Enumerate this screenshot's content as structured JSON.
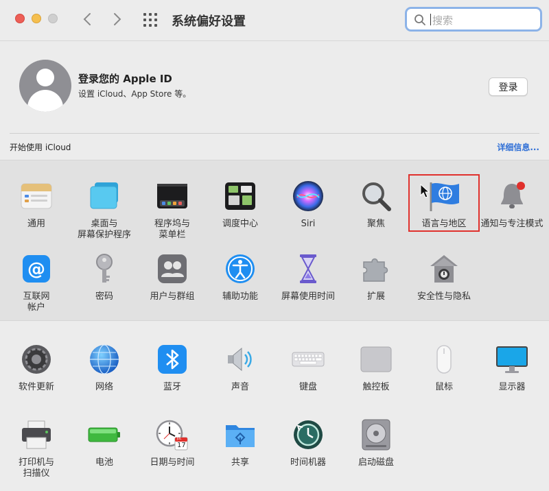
{
  "window": {
    "title": "系统偏好设置"
  },
  "search": {
    "placeholder": "搜索"
  },
  "account": {
    "title": "登录您的 Apple ID",
    "subtitle": "设置 iCloud、App Store 等。",
    "login_label": "登录",
    "icloud_label": "开始使用 iCloud",
    "details_label": "详细信息..."
  },
  "section1": [
    {
      "label": "通用",
      "icon": "general-icon"
    },
    {
      "label": "桌面与\n屏幕保护程序",
      "icon": "desktop-screensaver-icon"
    },
    {
      "label": "程序坞与\n菜单栏",
      "icon": "dock-menubar-icon"
    },
    {
      "label": "调度中心",
      "icon": "mission-control-icon"
    },
    {
      "label": "Siri",
      "icon": "siri-icon"
    },
    {
      "label": "聚焦",
      "icon": "spotlight-icon"
    },
    {
      "label": "语言与地区",
      "icon": "language-region-icon"
    },
    {
      "label": "通知与专注模式",
      "icon": "notifications-icon"
    },
    {
      "label": "互联网\n帐户",
      "icon": "internet-accounts-icon"
    },
    {
      "label": "密码",
      "icon": "passwords-icon"
    },
    {
      "label": "用户与群组",
      "icon": "users-groups-icon"
    },
    {
      "label": "辅助功能",
      "icon": "accessibility-icon"
    },
    {
      "label": "屏幕使用时间",
      "icon": "screen-time-icon"
    },
    {
      "label": "扩展",
      "icon": "extensions-icon"
    },
    {
      "label": "安全性与隐私",
      "icon": "security-privacy-icon"
    }
  ],
  "section2": [
    {
      "label": "软件更新",
      "icon": "software-update-icon"
    },
    {
      "label": "网络",
      "icon": "network-icon"
    },
    {
      "label": "蓝牙",
      "icon": "bluetooth-icon"
    },
    {
      "label": "声音",
      "icon": "sound-icon"
    },
    {
      "label": "键盘",
      "icon": "keyboard-icon"
    },
    {
      "label": "触控板",
      "icon": "trackpad-icon"
    },
    {
      "label": "鼠标",
      "icon": "mouse-icon"
    },
    {
      "label": "显示器",
      "icon": "displays-icon"
    },
    {
      "label": "打印机与\n扫描仪",
      "icon": "printers-scanners-icon"
    },
    {
      "label": "电池",
      "icon": "battery-icon"
    },
    {
      "label": "日期与时间",
      "icon": "date-time-icon"
    },
    {
      "label": "共享",
      "icon": "sharing-icon"
    },
    {
      "label": "时间机器",
      "icon": "time-machine-icon"
    },
    {
      "label": "启动磁盘",
      "icon": "startup-disk-icon"
    }
  ],
  "calendar_day": "17",
  "calendar_month": "JUL",
  "colors": {
    "accent": "#2f6fd6",
    "highlight": "#e0302c"
  }
}
